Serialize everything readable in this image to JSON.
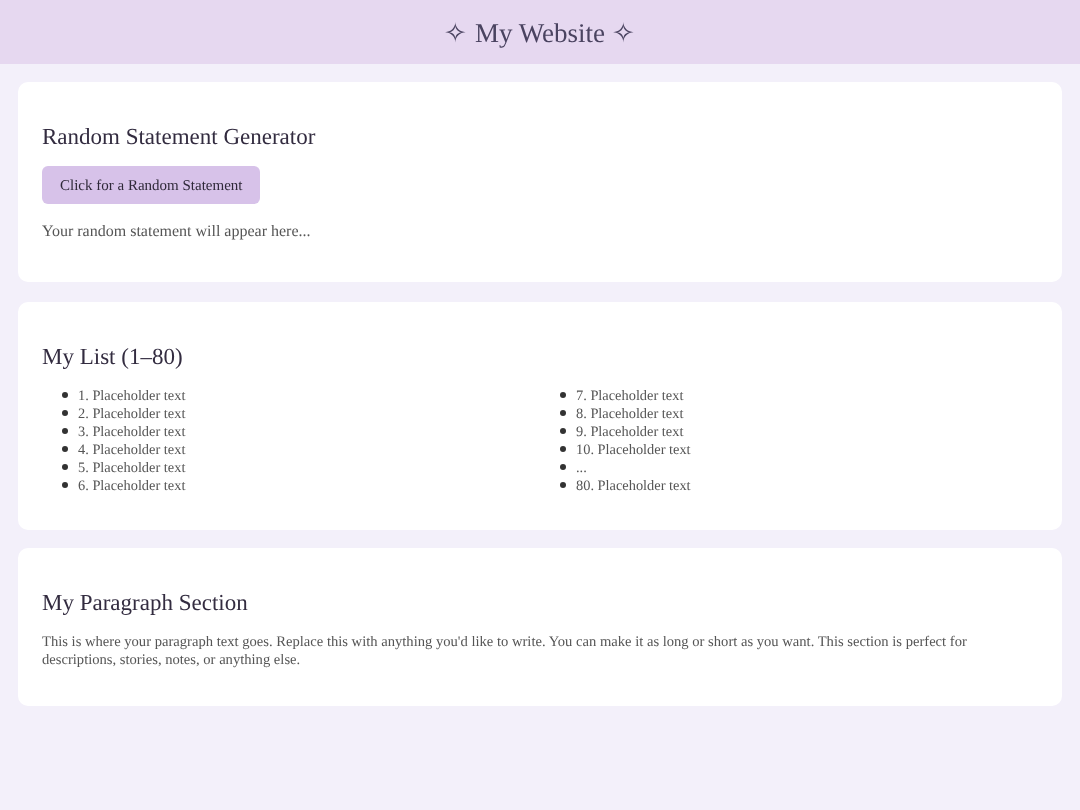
{
  "header": {
    "title": "✧ My Website ✧"
  },
  "generator": {
    "heading": "Random Statement Generator",
    "button": "Click for a Random Statement",
    "output": "Your random statement will appear here..."
  },
  "list": {
    "heading": "My List (1–80)",
    "columns": [
      [
        "1. Placeholder text",
        "2. Placeholder text",
        "3. Placeholder text",
        "4. Placeholder text",
        "5. Placeholder text",
        "6. Placeholder text"
      ],
      [
        "7. Placeholder text",
        "8. Placeholder text",
        "9. Placeholder text",
        "10. Placeholder text",
        "...",
        "80. Placeholder text"
      ]
    ]
  },
  "paragraph": {
    "heading": "My Paragraph Section",
    "text": "This is where your paragraph text goes. Replace this with anything you'd like to write. You can make it as long or short as you want. This section is perfect for descriptions, stories, notes, or anything else."
  }
}
